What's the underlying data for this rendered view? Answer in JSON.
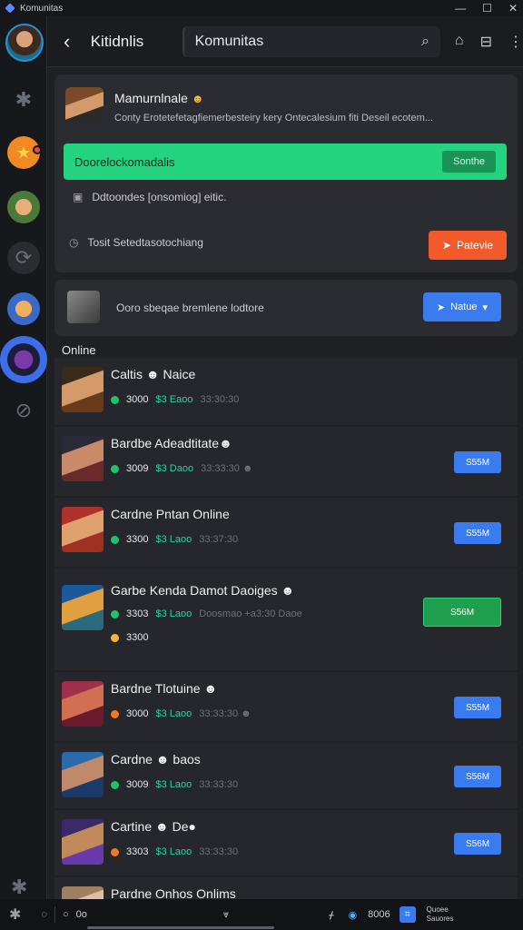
{
  "titlebar": {
    "title": "Komunitas",
    "controls": [
      "—",
      "☐",
      "✕"
    ]
  },
  "header": {
    "back_icon": "‹",
    "channel_name": "Kitidnlis",
    "search_value": "Komunitas",
    "search_icon": "search-icon",
    "actions": [
      "⌂",
      "⊟",
      "⋮"
    ]
  },
  "profile": {
    "name": "Mamurnlnale",
    "name_emoji": "☻",
    "description": "Conty Erotetefetagfiemerbesteiry kery Ontecalesium fiti Deseil ecotem...",
    "green_banner": "Doorelockomadalis",
    "green_button": "Sonthe",
    "row1_text": "Ddtoondes [onsomiog] eitic.",
    "row2_text": "Tosit Setedtasotochiang",
    "orange_button": "Patevie"
  },
  "community": {
    "text": "Ooro sbeqae bremlene lodtore",
    "button": "Natue"
  },
  "online_label": "Online",
  "members": [
    {
      "name": "Caltis",
      "emoji": "☻",
      "suffix": "Naice",
      "status": "#23c06a",
      "s1": "3000",
      "s2": "$3 Eaoo",
      "s3": "33:30:30",
      "button": "",
      "height": 76
    },
    {
      "name": "Bardbe",
      "emoji": "",
      "suffix": "Adeadtitate☻",
      "status": "#23c06a",
      "s1": "3009",
      "s2": "$3 Daoo",
      "s3": "33:33:30 ☻",
      "button": "S55M",
      "height": 78
    },
    {
      "name": "Cardne",
      "emoji": "",
      "suffix": "Pntan Online",
      "status": "#23c06a",
      "s1": "3300",
      "s2": "$3 Laoo",
      "s3": "33:37:30",
      "button": "S55M",
      "height": 78
    },
    {
      "name": "Garbe",
      "emoji": "",
      "suffix": "Kenda Damot Daoiges ☻",
      "status": "#23c06a",
      "s1": "3303",
      "s2": "$3 Laoo",
      "s3": "Doosmao +a3:30 Daoe",
      "s4": "3300",
      "button": "S56M",
      "green": true,
      "height": 114
    },
    {
      "name": "Bardne",
      "emoji": "",
      "suffix": "Tlotuine ☻",
      "status": "#f07a24",
      "s1": "3000",
      "s2": "$3 Laoo",
      "s3": "33:33:30 ☻",
      "button": "S55M",
      "height": 78
    },
    {
      "name": "Cardne",
      "emoji": "☻",
      "suffix": "baos",
      "status": "#23c06a",
      "s1": "3009",
      "s2": "$3 Laoo",
      "s3": "33:33:30",
      "button": "S56M",
      "height": 74
    },
    {
      "name": "Cartine",
      "emoji": "☻",
      "suffix": "De●",
      "status": "#f07a24",
      "s1": "3303",
      "s2": "$3 Laoo",
      "s3": "33:33:30",
      "button": "S56M",
      "height": 74
    },
    {
      "name": "Pardne",
      "emoji": "",
      "suffix": "Onhos Onlims",
      "status": "#23c06a",
      "s1": "",
      "s2": "",
      "s3": "",
      "button": "",
      "height": 40
    }
  ],
  "bottombar": {
    "left_text": "0o",
    "right_text1": "8006",
    "right_text2": "Quoee Sauores"
  }
}
